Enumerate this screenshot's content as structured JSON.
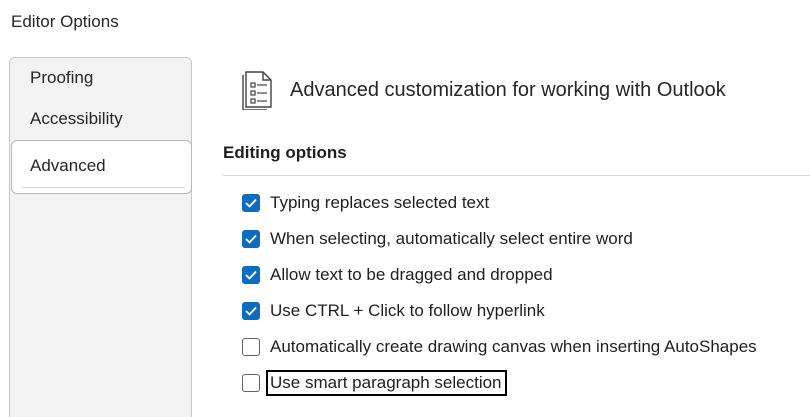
{
  "window": {
    "title": "Editor Options"
  },
  "sidebar": {
    "items": [
      {
        "label": "Proofing",
        "selected": false
      },
      {
        "label": "Accessibility",
        "selected": false
      },
      {
        "label": "Advanced",
        "selected": true
      }
    ]
  },
  "header": {
    "icon": "document-list-icon",
    "text": "Advanced customization for working with Outlook"
  },
  "section": {
    "heading": "Editing options"
  },
  "options": [
    {
      "label": "Typing replaces selected text",
      "checked": true
    },
    {
      "label": "When selecting, automatically select entire word",
      "checked": true
    },
    {
      "label": "Allow text to be dragged and dropped",
      "checked": true
    },
    {
      "label": "Use CTRL + Click to follow hyperlink",
      "checked": true
    },
    {
      "label": "Automatically create drawing canvas when inserting AutoShapes",
      "checked": false
    },
    {
      "label": "Use smart paragraph selection",
      "checked": false,
      "focused": true
    }
  ],
  "colors": {
    "accent": "#0f6cbd",
    "sidebar_bg": "#f3f3f3",
    "focus_outline": "#000000"
  }
}
